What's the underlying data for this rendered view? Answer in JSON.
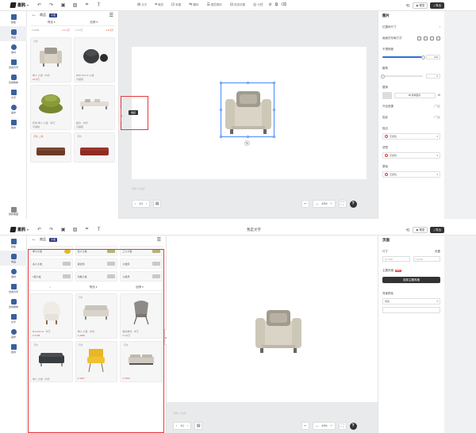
{
  "app": {
    "logo_text": "墨鸦",
    "caret": "▾",
    "center_title": "我是文字"
  },
  "topbar": {
    "left_icons": [
      {
        "name": "undo-icon",
        "glyph": "↶"
      },
      {
        "name": "redo-icon",
        "glyph": "↷"
      },
      {
        "name": "save-icon",
        "glyph": "▣"
      },
      {
        "name": "image-icon",
        "glyph": "▨"
      },
      {
        "name": "crop-icon",
        "glyph": "⌗"
      },
      {
        "name": "text-icon",
        "glyph": "T"
      }
    ],
    "tools": [
      "文字",
      "裁剪",
      "抠图",
      "翻转",
      "图层顺序",
      "投放设置",
      "分镜"
    ],
    "right_buttons": {
      "preview": "预览",
      "export": "导出"
    }
  },
  "rail": {
    "items": [
      "模板",
      "商品",
      "素材",
      "合成背景",
      "合成物体",
      "文字",
      "画布",
      "我的"
    ],
    "bottom_label": "我的收藏"
  },
  "library1": {
    "title": "商品",
    "tag": "沙发",
    "filters": [
      "筛选",
      "品牌"
    ],
    "top_row": [
      {
        "meta": "¥ 6568",
        "price": "¥ 4.1万"
      },
      {
        "meta": "¥ 3.5万",
        "price": "¥ 6.9万"
      }
    ],
    "cards": [
      {
        "badge": "同款",
        "meta": "单人 沙发 · 中式",
        "price": "¥4.6万"
      },
      {
        "badge": "",
        "meta": "B&B ITALIA 沙发",
        "price": "可编辑"
      },
      {
        "badge": "",
        "meta": "萨翁 单人 沙发 · 布艺",
        "price": "可编辑"
      },
      {
        "badge": "",
        "meta": "餐台 · 中式",
        "price": "可编辑"
      },
      {
        "badge": "同款 上新",
        "meta": "",
        "price": ""
      },
      {
        "badge": "同款",
        "meta": "",
        "price": ""
      }
    ]
  },
  "library2": {
    "title": "商品",
    "tag": "沙发",
    "categories": [
      {
        "label": "单人沙发",
        "thumb": "yellow"
      },
      {
        "label": "双人沙发",
        "thumb": "olive"
      },
      {
        "label": "三人沙发",
        "thumb": "olive"
      },
      {
        "label": "多人沙发",
        "thumb": "grey"
      },
      {
        "label": "贵妃椅",
        "thumb": "grey"
      },
      {
        "label": "沙发床",
        "thumb": "grey"
      },
      {
        "label": "L型沙发",
        "thumb": "grey"
      },
      {
        "label": "功能沙发",
        "thumb": "grey"
      },
      {
        "label": "沙发凳",
        "thumb": "grey"
      }
    ],
    "filters": [
      "筛选",
      "品牌"
    ],
    "cards": [
      {
        "badge": "",
        "meta": "BonaNova · 布艺",
        "price": "¥ 4728"
      },
      {
        "badge": "同款",
        "meta": "单人 沙发 · 中式",
        "price": "¥ 4908"
      },
      {
        "badge": "",
        "meta": "极简单椅 · 布艺",
        "price": "¥ 4.6万"
      },
      {
        "badge": "同款",
        "meta": "单人 沙发 · 中式",
        "price": ""
      },
      {
        "badge": "同款",
        "meta": "",
        "price": "¥ 4917"
      },
      {
        "badge": "同款",
        "meta": "",
        "price": "¥ 7490"
      }
    ]
  },
  "canvas": {
    "tooltip": "收起",
    "zoom": "43%",
    "page": "1/1",
    "zoom_minus": "—",
    "zoom_plus": "+",
    "watermark": "墨鸦 AI 生成",
    "help": "?"
  },
  "props1": {
    "title": "图片",
    "rows": [
      "位置和尺寸",
      "画面在布局方式",
      "不透明度",
      "圆角",
      "替换",
      "开启遮罩",
      "投影",
      "描边",
      "滤镜",
      "蒙版"
    ],
    "opacity_value": "100",
    "opacity_level": 1.0,
    "radius_value": "0",
    "radius_level": 0.0,
    "replace_label": "替换图片",
    "color_none": "无颜色"
  },
  "props2": {
    "title": "页面",
    "size_label": "尺寸",
    "size_action": "设置",
    "width_placeholder": "W  7680",
    "height_placeholder": "H  5360",
    "bg_label": "主题风格",
    "hot": "NEW",
    "bg_button": "选择主题风格",
    "bgcolor_label": "背景颜色",
    "bgcolor_value": "纯色"
  }
}
